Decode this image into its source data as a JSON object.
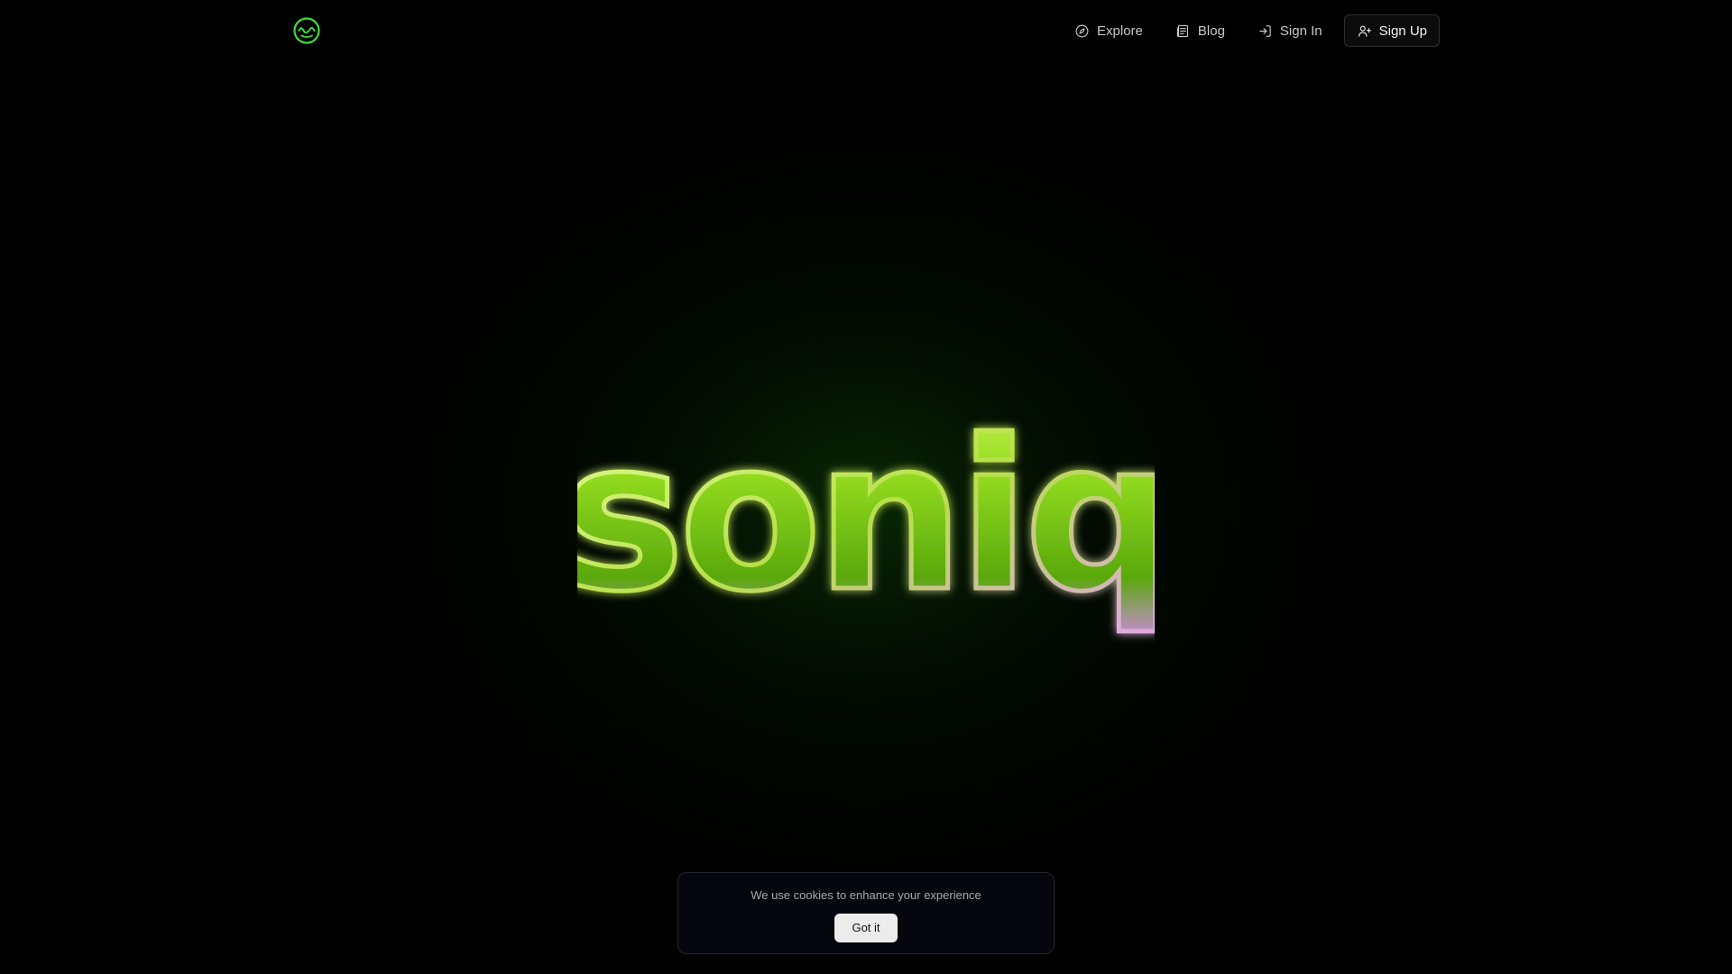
{
  "header": {
    "logo_icon": "waveform-circle-icon",
    "nav": [
      {
        "label": "Explore",
        "icon": "compass-icon"
      },
      {
        "label": "Blog",
        "icon": "newspaper-icon"
      },
      {
        "label": "Sign In",
        "icon": "log-in-icon"
      },
      {
        "label": "Sign Up",
        "icon": "user-plus-icon"
      }
    ]
  },
  "hero": {
    "wordmark": "soniq"
  },
  "cookie_banner": {
    "message": "We use cookies to enhance your experience",
    "button_label": "Got it"
  },
  "colors": {
    "accent_green": "#3fdc3a",
    "wordmark_green": "#7fd61a",
    "background": "#000000"
  }
}
